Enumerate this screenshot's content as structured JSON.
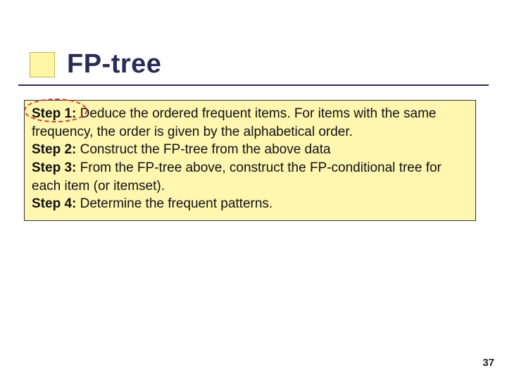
{
  "slide": {
    "title": "FP-tree",
    "steps": [
      {
        "label": "Step 1:",
        "text": " Deduce the ordered frequent items. For items with the same frequency, the order is given by the alphabetical order."
      },
      {
        "label": "Step 2:",
        "text": " Construct the FP-tree from the above data"
      },
      {
        "label": "Step 3:",
        "text": " From the FP-tree above, construct the FP-conditional tree for each item (or itemset)."
      },
      {
        "label": "Step 4:",
        "text": " Determine the frequent patterns."
      }
    ],
    "page_number": "37"
  }
}
